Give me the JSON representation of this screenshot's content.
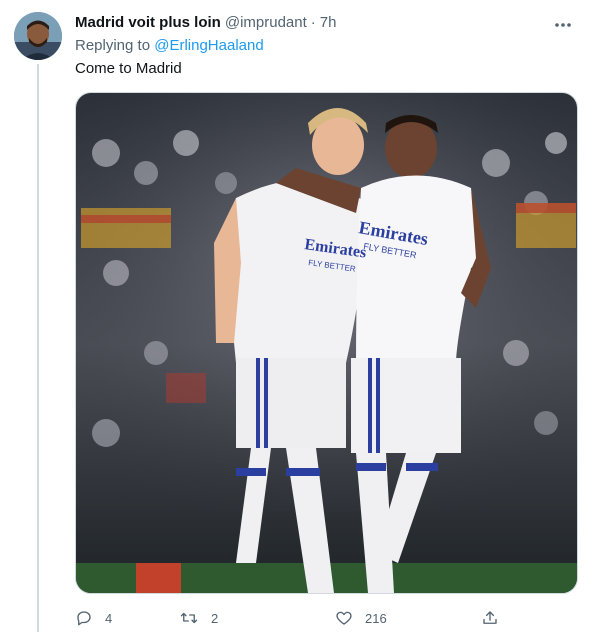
{
  "tweet": {
    "display_name": "Madrid voit plus loin",
    "handle": "@imprudant",
    "separator": "·",
    "time": "7h",
    "replying_prefix": "Replying to",
    "replying_to": "@ErlingHaaland",
    "text": "Come to Madrid"
  },
  "media": {
    "jersey_sponsor_1": "Emirates",
    "jersey_sponsor_1_sub": "FLY BETTER",
    "jersey_sponsor_2": "Emirates",
    "jersey_sponsor_2_sub": "FLY BETTER"
  },
  "actions": {
    "reply_count": "4",
    "retweet_count": "2",
    "like_count": "216",
    "icons": [
      "reply-icon",
      "retweet-icon",
      "like-icon",
      "share-icon"
    ]
  },
  "colors": {
    "text_primary": "#0f1419",
    "text_secondary": "#536471",
    "link": "#1d9bf0",
    "divider": "#cfd9de"
  }
}
